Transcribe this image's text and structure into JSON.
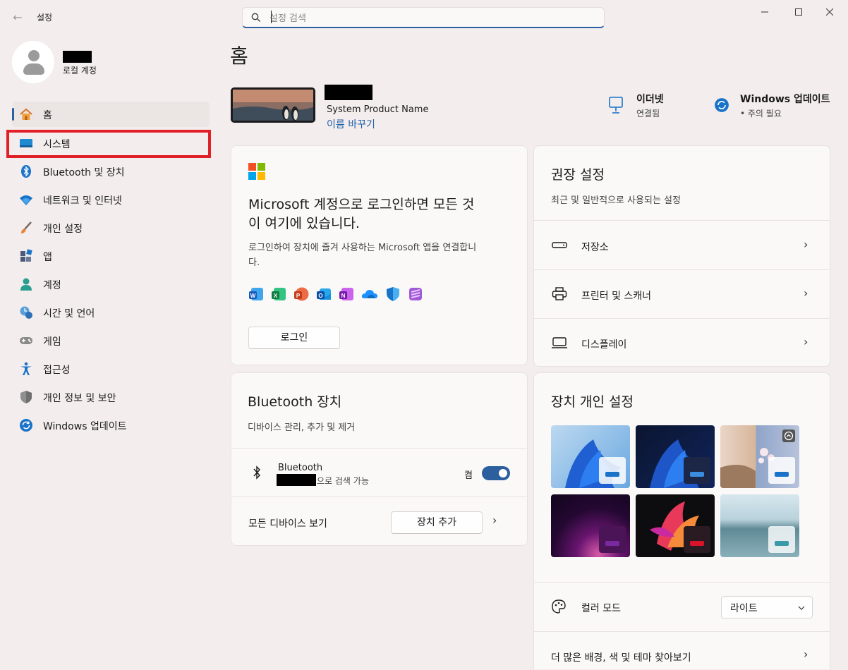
{
  "window": {
    "title": "설정"
  },
  "search": {
    "placeholder": "설정 검색"
  },
  "profile": {
    "account_type": "로컬 계정"
  },
  "sidebar": {
    "items": [
      {
        "label": "홈",
        "icon": "home-icon"
      },
      {
        "label": "시스템",
        "icon": "system-icon"
      },
      {
        "label": "Bluetooth 및 장치",
        "icon": "bluetooth-icon"
      },
      {
        "label": "네트워크 및 인터넷",
        "icon": "wifi-icon"
      },
      {
        "label": "개인 설정",
        "icon": "brush-icon"
      },
      {
        "label": "앱",
        "icon": "apps-icon"
      },
      {
        "label": "계정",
        "icon": "person-icon"
      },
      {
        "label": "시간 및 언어",
        "icon": "clock-globe-icon"
      },
      {
        "label": "게임",
        "icon": "gamepad-icon"
      },
      {
        "label": "접근성",
        "icon": "accessibility-icon"
      },
      {
        "label": "개인 정보 및 보안",
        "icon": "shield-icon"
      },
      {
        "label": "Windows 업데이트",
        "icon": "update-icon"
      }
    ]
  },
  "main": {
    "title": "홈",
    "device": {
      "name": "System Product Name",
      "rename": "이름 바꾸기"
    },
    "ethernet": {
      "title": "이더넷",
      "status": "연결됨"
    },
    "update": {
      "title": "Windows 업데이트",
      "status": "• 주의 필요"
    },
    "ms_card": {
      "heading_line1": "Microsoft 계정으로 로그인하면 모든 것",
      "heading_line2": "이 여기에 있습니다.",
      "desc_line1": "로그인하여 장치에 즐겨 사용하는 Microsoft 앱을 연결합니",
      "desc_line2": "다.",
      "button": "로그인",
      "apps": [
        "word-icon",
        "excel-icon",
        "powerpoint-icon",
        "outlook-icon",
        "onenote-icon",
        "onedrive-icon",
        "defender-icon",
        "clipchamp-icon"
      ]
    },
    "recommended": {
      "title": "권장 설정",
      "subtitle": "최근 및 일반적으로 사용되는 설정",
      "items": [
        {
          "label": "저장소",
          "icon": "storage-icon"
        },
        {
          "label": "프린터 및 스캐너",
          "icon": "printer-icon"
        },
        {
          "label": "디스플레이",
          "icon": "display-icon"
        }
      ]
    },
    "bluetooth_card": {
      "title": "Bluetooth 장치",
      "subtitle": "디바이스 관리, 추가 및 제거",
      "bt_label": "Bluetooth",
      "bt_suffix": "으로 검색 가능",
      "toggle_state": "켬",
      "toggle_on": true,
      "all_devices": "모든 디바이스 보기",
      "add_device": "장치 추가"
    },
    "personalize": {
      "title": "장치 개인 설정",
      "color_mode_label": "컬러 모드",
      "color_mode_value": "라이트",
      "more_link": "더 많은 배경, 색 및 테마 찾아보기"
    }
  }
}
